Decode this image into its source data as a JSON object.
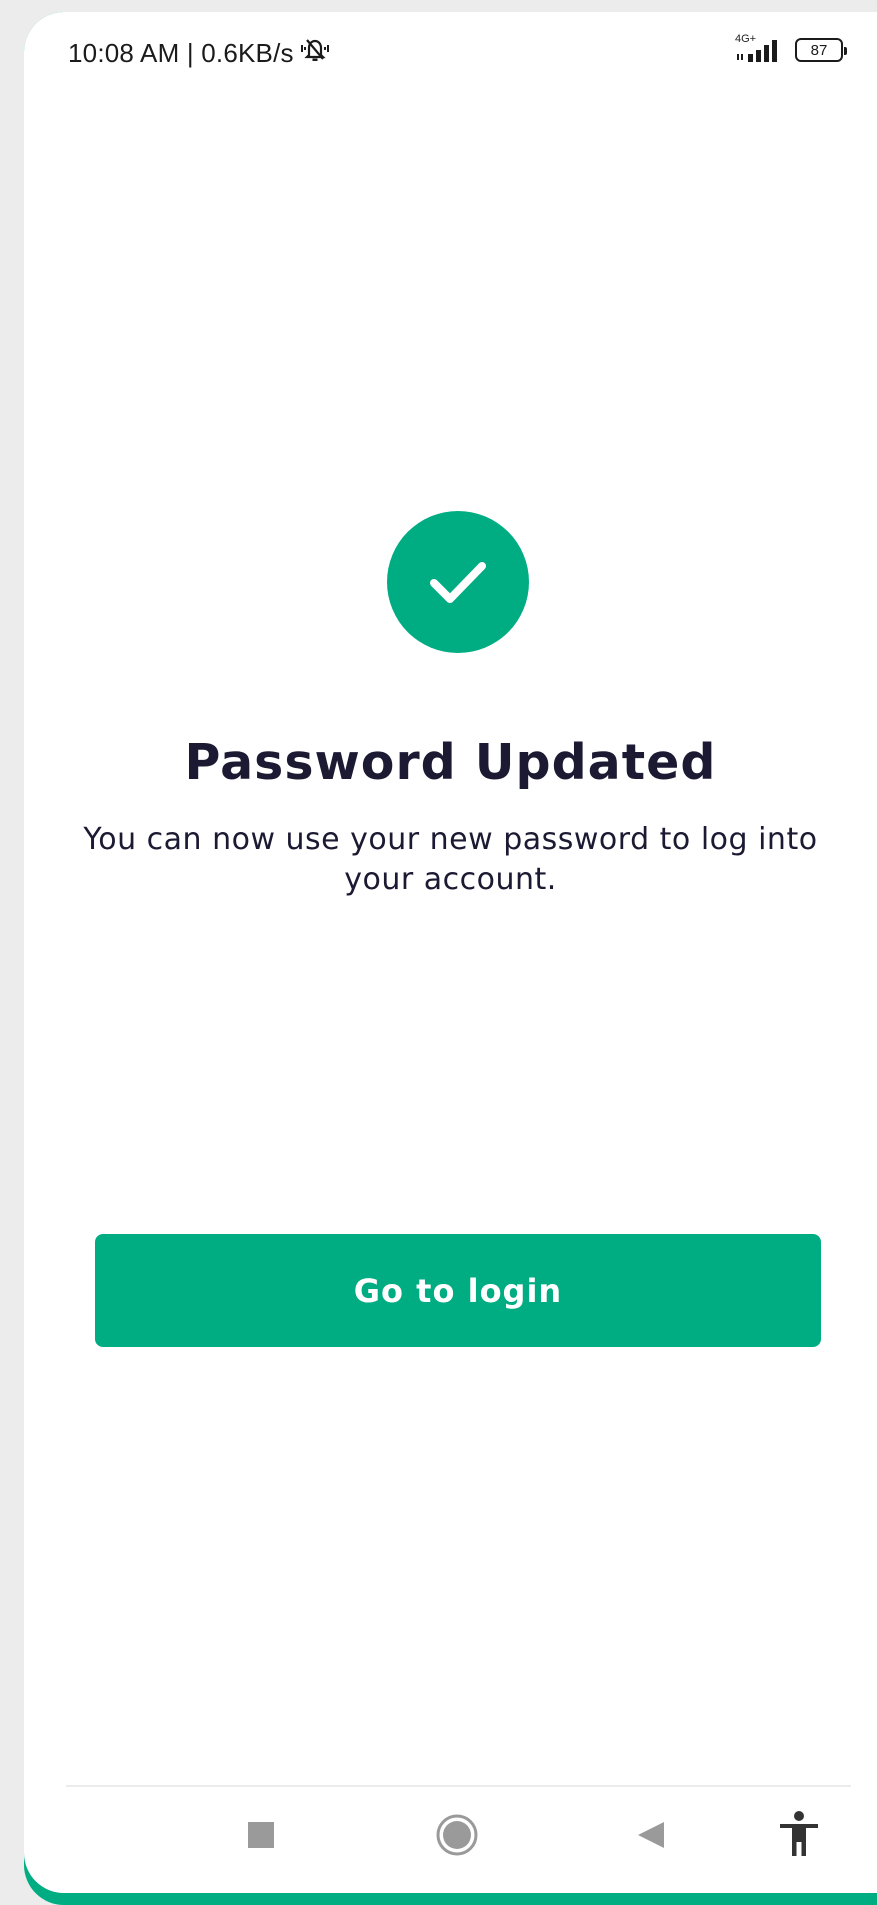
{
  "status_bar": {
    "time_speed": "10:08 AM | 0.6KB/s",
    "network": "4G+",
    "battery": "87",
    "icons": [
      "muted-bell-icon",
      "signal-icon",
      "battery-icon"
    ]
  },
  "main": {
    "icon": "check-circle-icon",
    "title": "Password Updated",
    "message": "You can now use your new password to log into your account.",
    "button_label": "Go to login"
  },
  "nav_bar": {
    "icons": [
      "recents-square-icon",
      "home-circle-icon",
      "back-triangle-icon",
      "accessibility-icon"
    ]
  },
  "colors": {
    "accent": "#00ad82",
    "title_text": "#1c1a33",
    "background": "#ffffff"
  }
}
